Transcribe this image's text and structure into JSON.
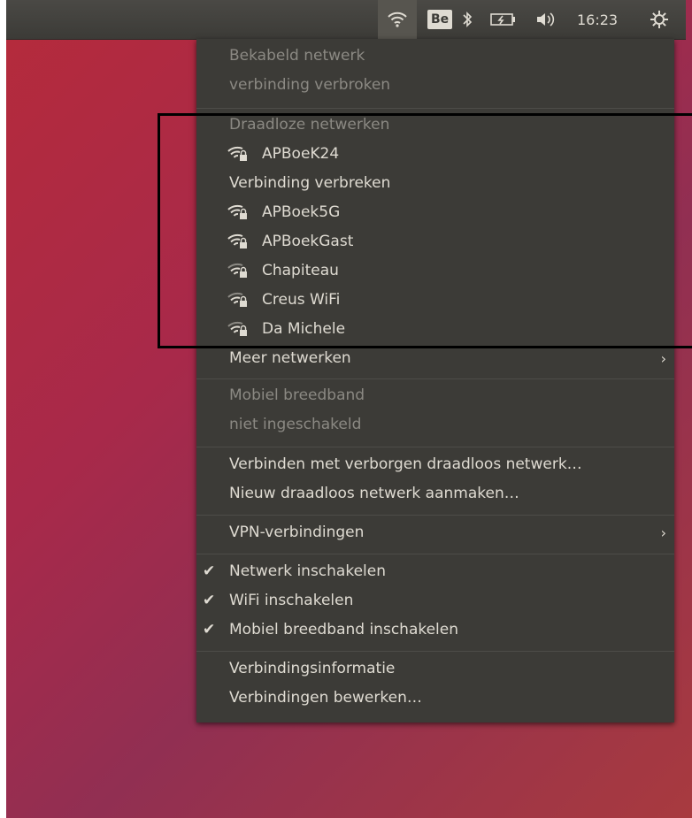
{
  "topbar": {
    "wifi_icon": "wifi-icon",
    "keyboard_layout": "Be",
    "bluetooth_glyph": "✱",
    "volume_glyph": "◀))",
    "time": "16:23",
    "gear_glyph": "⚙"
  },
  "menu": {
    "wired": {
      "header": "Bekabeld netwerk",
      "status": "verbinding verbroken"
    },
    "wireless": {
      "header": "Draadloze netwerken",
      "networks": [
        "APBoeK24",
        "APBoek5G",
        "APBoekGast",
        "Chapiteau",
        "Creus WiFi",
        "Da Michele"
      ],
      "disconnect": "Verbinding verbreken",
      "more": "Meer netwerken"
    },
    "mobile": {
      "header": "Mobiel breedband",
      "status": "niet ingeschakeld"
    },
    "connect_hidden": "Verbinden met verborgen draadloos netwerk…",
    "create_new": "Nieuw draadloos netwerk aanmaken…",
    "vpn": "VPN-verbindingen",
    "toggles": {
      "network": "Netwerk inschakelen",
      "wifi": "WiFi inschakelen",
      "mobile": "Mobiel breedband inschakelen",
      "checkmark": "✔"
    },
    "connection_info": "Verbindingsinformatie",
    "edit_connections": "Verbindingen bewerken…",
    "submenu_arrow": "›"
  },
  "colors": {
    "panel": "#3c3b37",
    "text": "#dfdbd2",
    "disabled_text": "#8b8983",
    "desktop": "#a8294a",
    "highlight_border": "#000000"
  }
}
